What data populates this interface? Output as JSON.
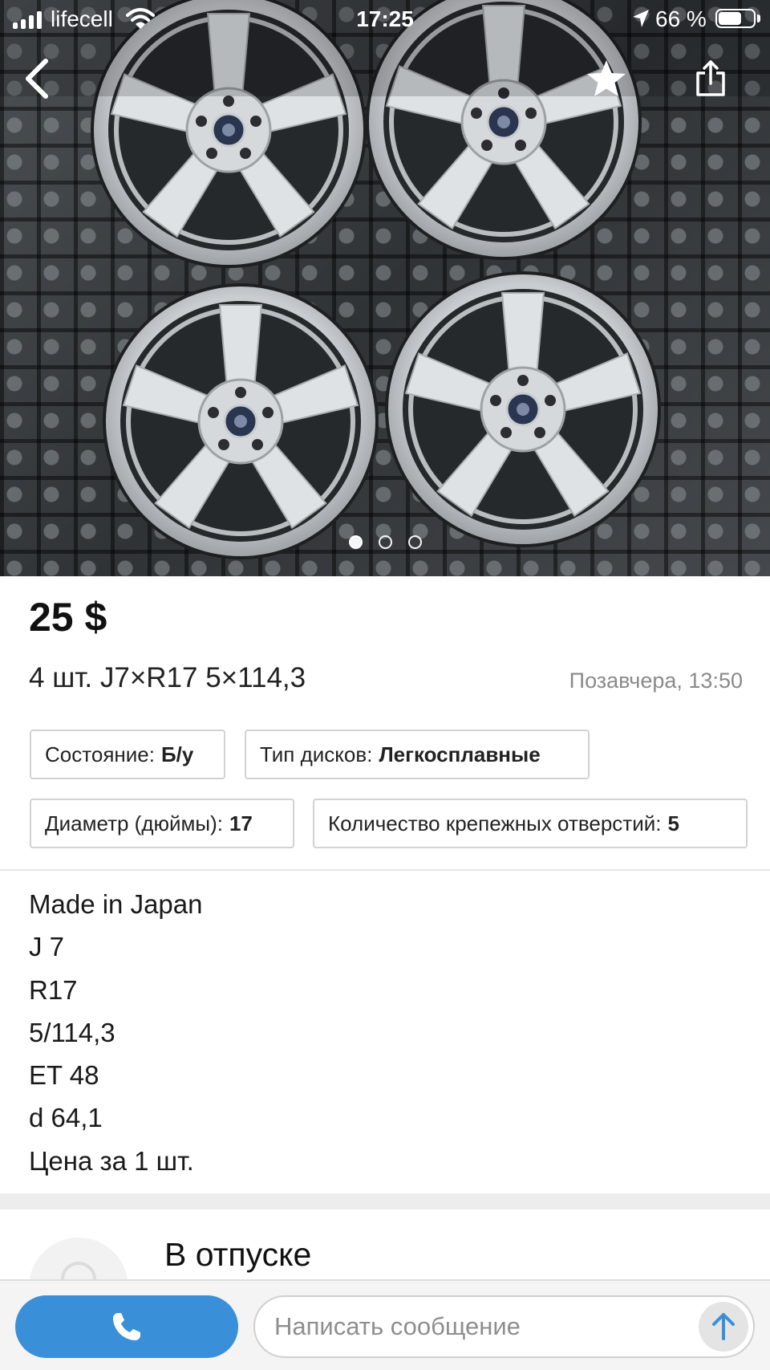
{
  "status_bar": {
    "carrier": "lifecell",
    "time": "17:25",
    "battery_percent": "66 %",
    "battery_level": 0.66
  },
  "gallery": {
    "photo_count": 3,
    "active_index": 0
  },
  "listing": {
    "price": "25 $",
    "title": "4 шт. J7×R17 5×114,3",
    "posted": "Позавчера, 13:50"
  },
  "attributes": [
    {
      "label": "Состояние:",
      "value": "Б/у"
    },
    {
      "label": "Тип дисков:",
      "value": "Легкосплавные"
    },
    {
      "label": "Диаметр (дюймы):",
      "value": "17"
    },
    {
      "label": "Количество крепежных отверстий:",
      "value": "5"
    }
  ],
  "description": [
    "Made in Japan",
    "J 7",
    "R17",
    "5/114,3",
    "ET 48",
    "d 64,1",
    "Цена за 1 шт."
  ],
  "seller": {
    "status": "В отпуске"
  },
  "bottom_bar": {
    "message_placeholder": "Написать сообщение"
  },
  "icons": {
    "back": "chevron-left-icon",
    "favorite": "star-icon",
    "share": "share-icon",
    "call": "phone-icon",
    "send": "arrow-up-icon"
  },
  "colors": {
    "accent": "#3a8fd9",
    "muted_text": "#8a8a8a",
    "chip_border": "#d2d2d2",
    "band": "#ededed"
  }
}
